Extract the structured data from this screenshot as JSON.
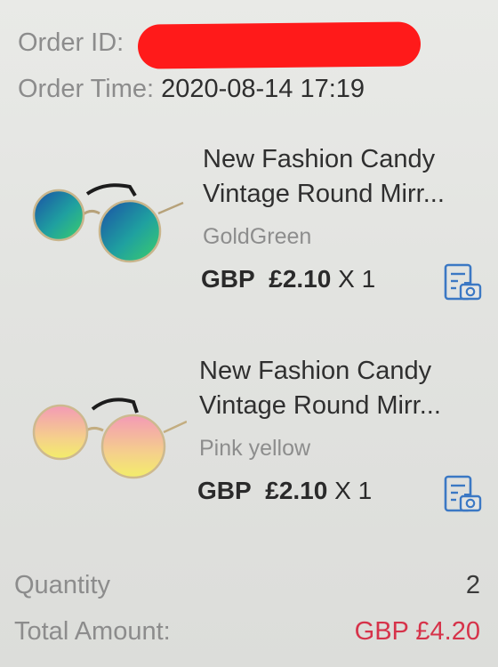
{
  "order": {
    "id_label": "Order ID:",
    "time_label": "Order Time:",
    "time_value": "2020-08-14 17:19"
  },
  "products": [
    {
      "title_line1": "New Fashion Candy",
      "title_line2": "Vintage Round Mirr...",
      "variant": "GoldGreen",
      "currency": "GBP",
      "price": "£2.10",
      "quantity": "X 1",
      "image_icon": "sunglasses-image",
      "snapshot_icon": "order-snapshot-icon",
      "lens_colors": [
        "#1f5fb0",
        "#2fb87a"
      ]
    },
    {
      "title_line1": "New Fashion Candy",
      "title_line2": "Vintage Round Mirr...",
      "variant": "Pink yellow",
      "currency": "GBP",
      "price": "£2.10",
      "quantity": "X 1",
      "image_icon": "sunglasses-image",
      "snapshot_icon": "order-snapshot-icon",
      "lens_colors": [
        "#f4a3b8",
        "#f2e36a"
      ]
    }
  ],
  "summary": {
    "quantity_label": "Quantity",
    "quantity_value": "2",
    "total_label": "Total Amount:",
    "total_value": "GBP £4.20"
  },
  "colors": {
    "accent_red": "#d6334a",
    "redaction": "#ff1a1a",
    "icon_blue": "#3b78c4"
  }
}
